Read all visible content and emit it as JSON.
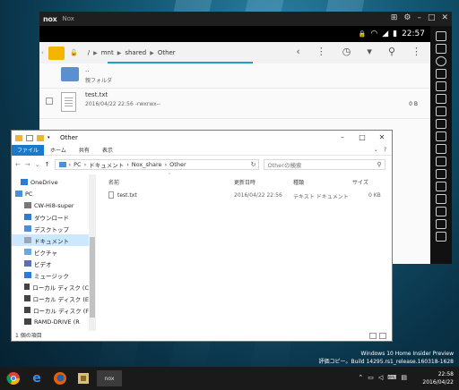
{
  "colors": {
    "accent": "#1979ca",
    "nox_teal": "#1aa3b8",
    "folder_yellow": "#f5b400",
    "selection": "#cce8ff"
  },
  "nox": {
    "logo": "nox",
    "app_name": "Nox",
    "status_time": "22:57",
    "breadcrumb": [
      "/",
      "mnt",
      "shared",
      "Other"
    ],
    "rows": [
      {
        "name": "..",
        "sub": "親フォルダ",
        "size": ""
      },
      {
        "name": "test.txt",
        "sub": "2016/04/22 22:56  -rwxrwx--",
        "size": "0 B"
      }
    ]
  },
  "explorer": {
    "title": "Other",
    "ribbon_tabs": [
      "ファイル",
      "ホーム",
      "共有",
      "表示"
    ],
    "address_path": [
      "PC",
      "ドキュメント",
      "Nox_share",
      "Other"
    ],
    "search_placeholder": "Otherの検索",
    "tree": [
      {
        "label": "OneDrive",
        "icon": "cloud-icon"
      },
      {
        "label": "PC",
        "icon": "pc-icon"
      },
      {
        "label": "CW-Hi8-super",
        "icon": "drive-icon"
      },
      {
        "label": "ダウンロード",
        "icon": "download-icon"
      },
      {
        "label": "デスクトップ",
        "icon": "desktop-icon"
      },
      {
        "label": "ドキュメント",
        "icon": "documents-icon"
      },
      {
        "label": "ピクチャ",
        "icon": "pictures-icon"
      },
      {
        "label": "ビデオ",
        "icon": "video-icon"
      },
      {
        "label": "ミュージック",
        "icon": "music-icon"
      },
      {
        "label": "ローカル ディスク (C",
        "icon": "disk-icon"
      },
      {
        "label": "ローカル ディスク (E",
        "icon": "disk-icon"
      },
      {
        "label": "ローカル ディスク (F",
        "icon": "disk-icon"
      },
      {
        "label": "RAMD-DRIVE (R",
        "icon": "disk-icon"
      }
    ],
    "columns": [
      "名前",
      "更新日時",
      "種類",
      "サイズ"
    ],
    "files": [
      {
        "name": "test.txt",
        "modified": "2016/04/22 22:56",
        "type": "テキスト ドキュメント",
        "size": "0 KB"
      }
    ],
    "status": "1 個の項目"
  },
  "desktop": {
    "build_line1": "Windows 10 Home Insider Preview",
    "build_line2": "評価コピー。Build 14295.rs1_release.160318-1628"
  },
  "taskbar": {
    "nox_label": "nox",
    "time": "22:58",
    "date": "2016/04/22"
  }
}
